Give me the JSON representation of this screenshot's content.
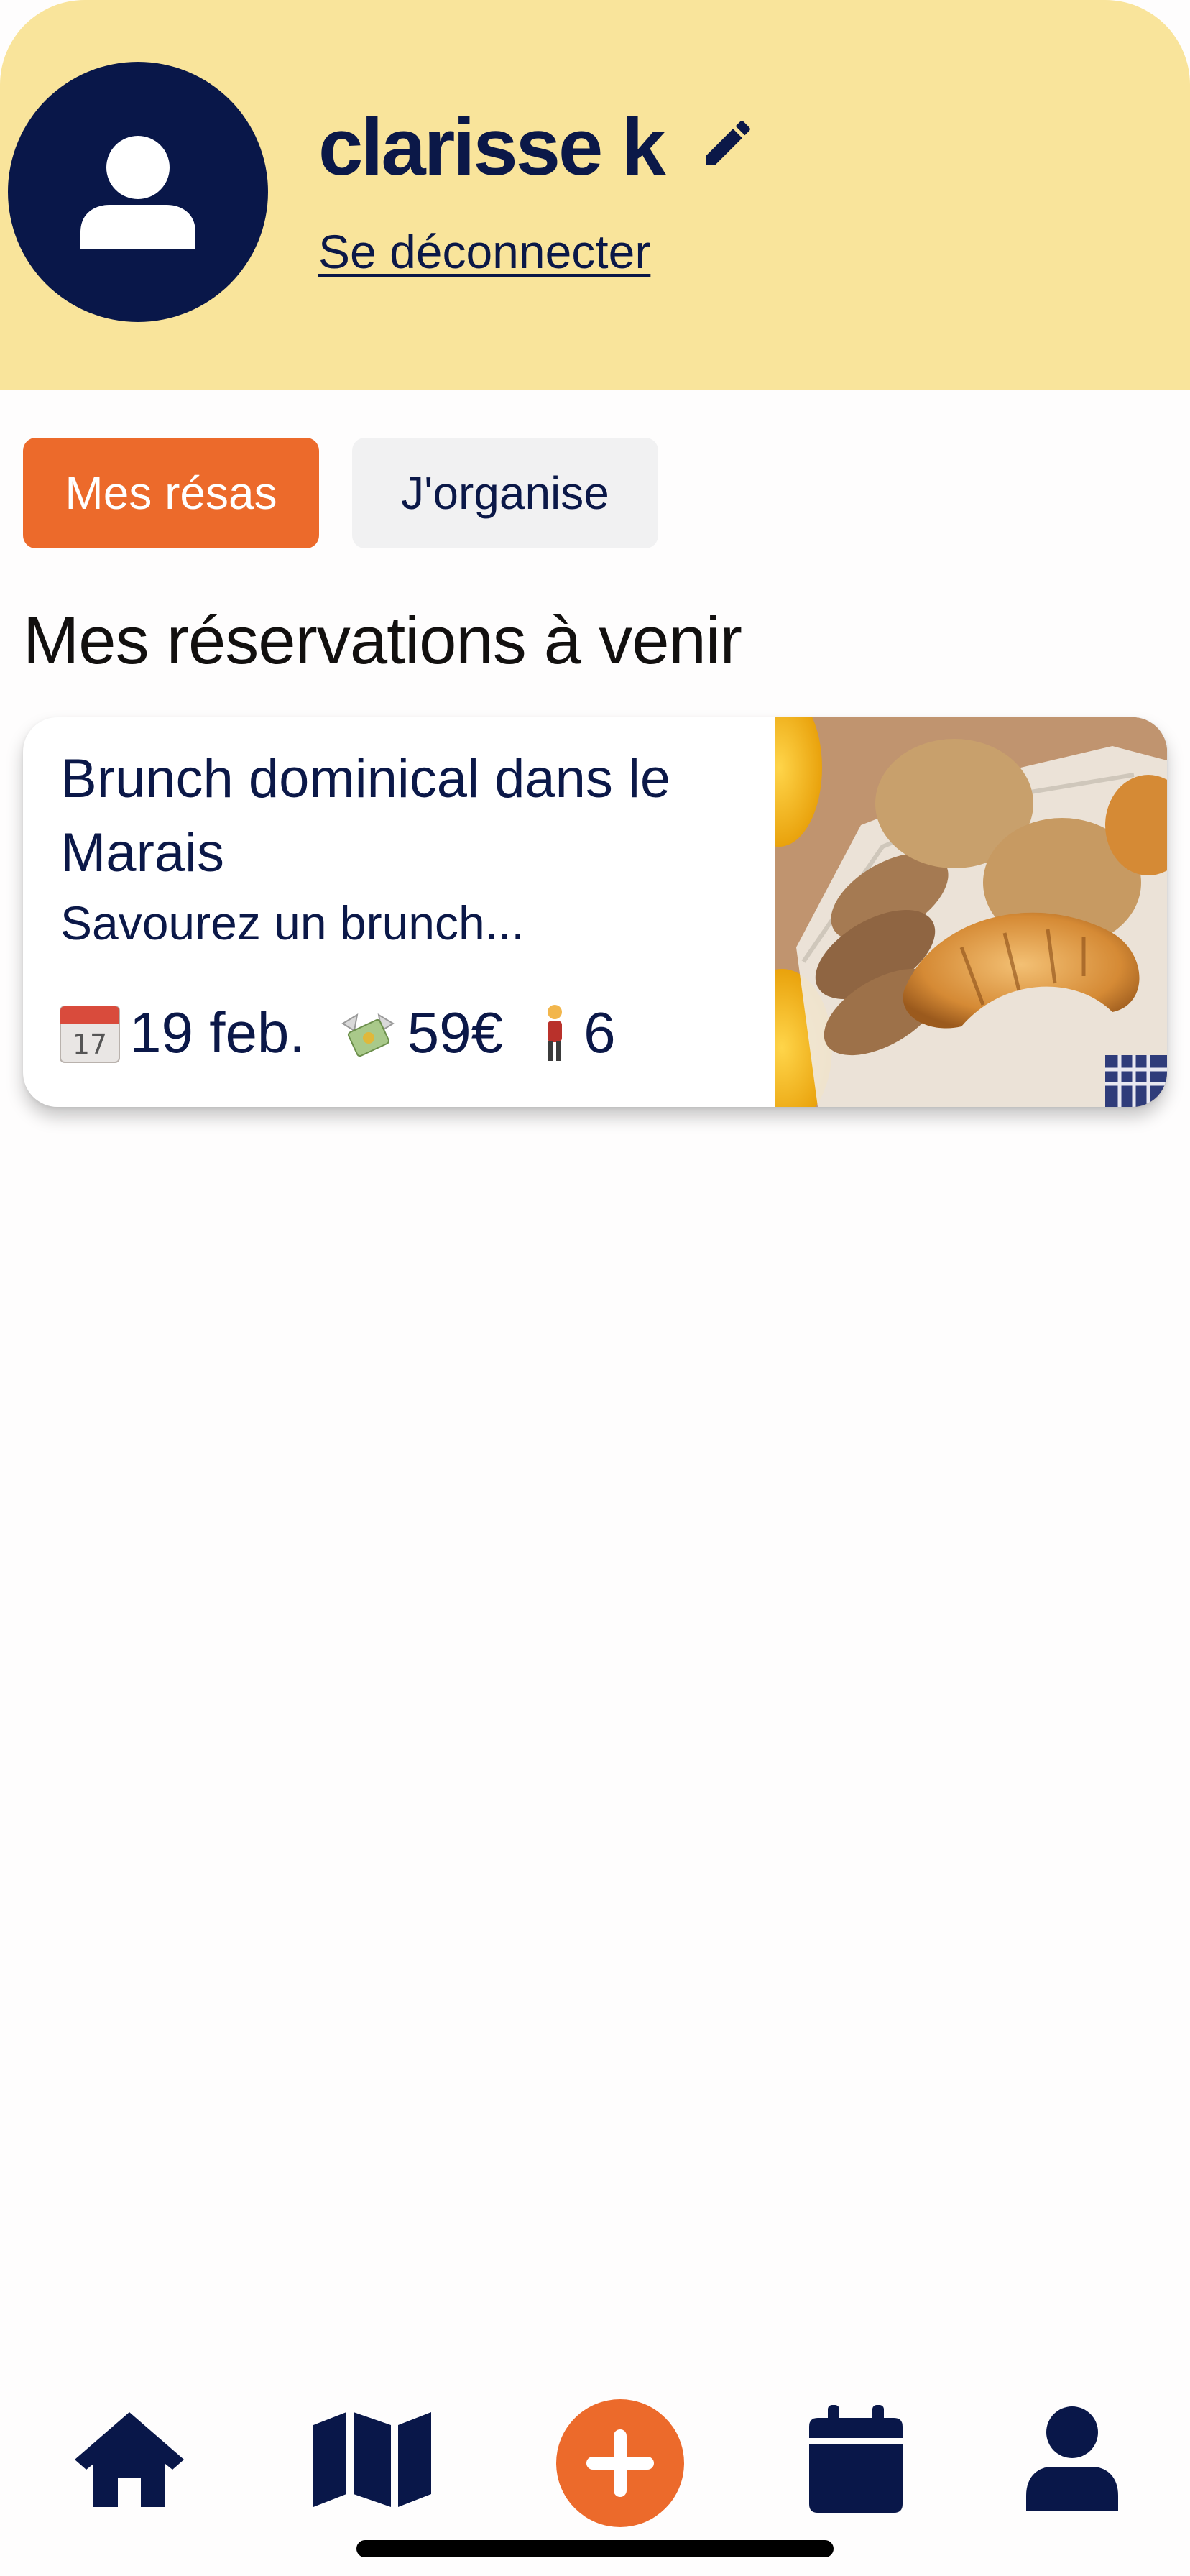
{
  "profile": {
    "name": "clarisse k",
    "logout_label": "Se déconnecter"
  },
  "tabs": [
    {
      "label": "Mes résas",
      "active": true
    },
    {
      "label": "J'organise",
      "active": false
    }
  ],
  "section_title": "Mes réservations à venir",
  "reservations": [
    {
      "title": "Brunch dominical dans le Marais",
      "description": "Savourez un brunch...",
      "date": "19 feb.",
      "price": "59€",
      "guests": "6",
      "image": "croissants-bread-basket-photo"
    }
  ],
  "bottom_nav": {
    "items": [
      "home-icon",
      "map-icon",
      "add-icon",
      "calendar-icon",
      "profile-icon"
    ]
  },
  "colors": {
    "header_bg": "#f9e49b",
    "navy": "#0b1848",
    "accent": "#ec6a2b",
    "inactive_tab_bg": "#f1f1f2"
  }
}
